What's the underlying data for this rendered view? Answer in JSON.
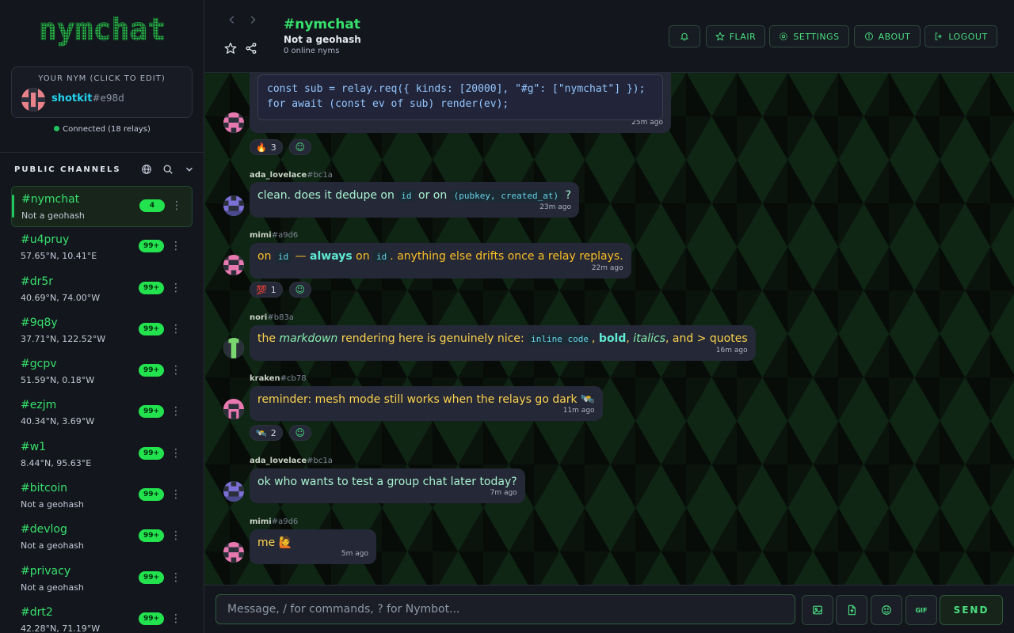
{
  "app": {
    "logo_text": "nymchat"
  },
  "user": {
    "caption": "YOUR NYM (CLICK TO EDIT)",
    "name": "shotkit",
    "suffix": "#e98d",
    "connection": "Connected (18 relays)"
  },
  "sidebar": {
    "section_title": "PUBLIC CHANNELS",
    "channels": [
      {
        "name": "#nymchat",
        "sub": "Not a geohash",
        "badge": "4"
      },
      {
        "name": "#u4pruy",
        "sub": "57.65°N, 10.41°E",
        "badge": "99+"
      },
      {
        "name": "#dr5r",
        "sub": "40.69°N, 74.00°W",
        "badge": "99+"
      },
      {
        "name": "#9q8y",
        "sub": "37.71°N, 122.52°W",
        "badge": "99+"
      },
      {
        "name": "#gcpv",
        "sub": "51.59°N, 0.18°W",
        "badge": "99+"
      },
      {
        "name": "#ezjm",
        "sub": "40.34°N, 3.69°W",
        "badge": "99+"
      },
      {
        "name": "#w1",
        "sub": "8.44°N, 95.63°E",
        "badge": "99+"
      },
      {
        "name": "#bitcoin",
        "sub": "Not a geohash",
        "badge": "99+"
      },
      {
        "name": "#devlog",
        "sub": "Not a geohash",
        "badge": "99+"
      },
      {
        "name": "#privacy",
        "sub": "Not a geohash",
        "badge": "99+"
      },
      {
        "name": "#drt2",
        "sub": "42.28°N, 71.19°W",
        "badge": "99+"
      }
    ]
  },
  "header": {
    "title": "#nymchat",
    "subtitle": "Not a geohash",
    "online": "0 online nyms",
    "buttons": {
      "flair": "FLAIR",
      "settings": "SETTINGS",
      "about": "ABOUT",
      "logout": "LOGOUT"
    }
  },
  "messages": {
    "m0": {
      "code_line1": "const sub = relay.req({ kinds: [20000], \"#g\": [\"nymchat\"] });",
      "code_line2": "for await (const ev of sub) render(ev);",
      "time": "25m ago",
      "reaction": {
        "emoji": "🔥",
        "count": "3"
      }
    },
    "m1": {
      "author": "ada_lovelace",
      "tag": "#bc1a",
      "t1": "clean. does it dedupe on ",
      "c1": "id",
      "t2": " or on ",
      "c2": "(pubkey, created_at)",
      "t3": " ?",
      "time": "23m ago"
    },
    "m2": {
      "author": "mimi",
      "tag": "#a9d6",
      "t1": "on ",
      "c1": "id",
      "t2": " — ",
      "b1": "always",
      "t3": " on ",
      "c2": "id",
      "t4": ". anything else drifts once a relay replays.",
      "time": "22m ago",
      "reaction": {
        "emoji": "💯",
        "count": "1"
      }
    },
    "m3": {
      "author": "nori",
      "tag": "#b83a",
      "t1": "the ",
      "i1": "markdown",
      "t2": " rendering here is genuinely nice: ",
      "c1": "inline code",
      "t3": ", ",
      "b1": "bold",
      "t4": ", ",
      "i2": "italics",
      "t5": ", and > quotes",
      "time": "16m ago"
    },
    "m4": {
      "author": "kraken",
      "tag": "#cb78",
      "text": "reminder: mesh mode still works when the relays go dark 🛰️",
      "time": "11m ago",
      "reaction": {
        "emoji": "🛰️",
        "count": "2"
      }
    },
    "m5": {
      "author": "ada_lovelace",
      "tag": "#bc1a",
      "text": "ok who wants to test a group chat later today?",
      "time": "7m ago"
    },
    "m6": {
      "author": "mimi",
      "tag": "#a9d6",
      "text": "me 🙋",
      "time": "5m ago"
    }
  },
  "composer": {
    "placeholder": "Message, / for commands, ? for Nymbot...",
    "gif_label": "GIF",
    "send_label": "SEND"
  },
  "colors": {
    "accent": "#22c55e",
    "badge": "#22e34e",
    "bubble": "#252836",
    "bg": "#14161e"
  }
}
